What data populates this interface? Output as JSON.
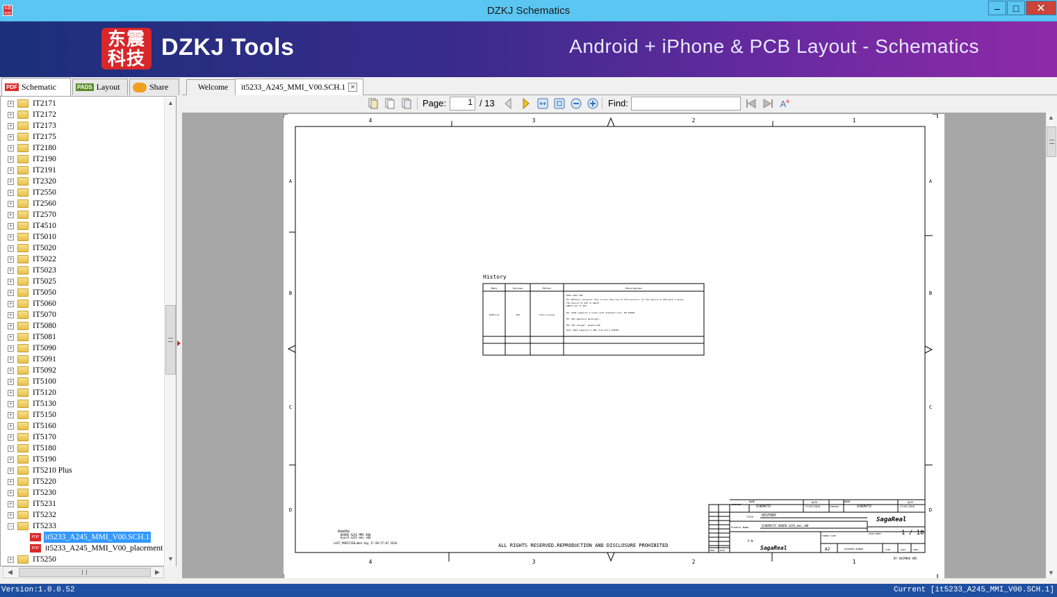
{
  "window": {
    "title": "DZKJ Schematics",
    "icon_text": "东震科技",
    "min": "–",
    "max": "□",
    "close": "✕"
  },
  "banner": {
    "logo_text": "东震科技",
    "brand": "DZKJ Tools",
    "tagline": "Android + iPhone & PCB Layout - Schematics"
  },
  "left_tabs": [
    {
      "badge": "PDF",
      "label": "Schematic",
      "active": true
    },
    {
      "badge": "PADS",
      "label": "Layout",
      "active": false
    },
    {
      "badge": "",
      "label": "Share",
      "active": false
    }
  ],
  "tree": {
    "folders": [
      "IT2171",
      "IT2172",
      "IT2173",
      "IT2175",
      "IT2180",
      "IT2190",
      "IT2191",
      "IT2320",
      "IT2550",
      "IT2560",
      "IT2570",
      "IT4510",
      "IT5010",
      "IT5020",
      "IT5022",
      "IT5023",
      "IT5025",
      "IT5050",
      "IT5060",
      "IT5070",
      "IT5080",
      "IT5081",
      "IT5090",
      "IT5091",
      "IT5092",
      "IT5100",
      "IT5120",
      "IT5130",
      "IT5150",
      "IT5160",
      "IT5170",
      "IT5180",
      "IT5190",
      "IT5210 Plus",
      "IT5220",
      "IT5230",
      "IT5231",
      "IT5232",
      "IT5233"
    ],
    "expanded_folder": "IT5233",
    "children": [
      "it5233_A245_MMI_V00.SCH.1",
      "it5233_A245_MMI_V00_placement"
    ],
    "selected_child": "it5233_A245_MMI_V00.SCH.1",
    "after": [
      "IT5250"
    ],
    "expand_symbol": "+",
    "collapse_symbol": "−"
  },
  "doc_tabs": [
    {
      "label": "Welcome",
      "active": false
    },
    {
      "label": "it5233_A245_MMI_V00.SCH.1",
      "active": true,
      "close": "✕"
    }
  ],
  "toolbar": {
    "page_label": "Page:",
    "page_value": "1",
    "page_total": "/ 13",
    "find_label": "Find:",
    "find_value": ""
  },
  "schematic": {
    "col_labels_top": [
      "4",
      "3",
      "2",
      "1"
    ],
    "row_labels": [
      "A",
      "B",
      "C",
      "D"
    ],
    "history_title": "History",
    "history_headers": [
      "Date",
      "Version",
      "Editor",
      "Description"
    ],
    "history_row": {
      "date": "2018/7/4",
      "version": "V00",
      "editor": "zhou xinrong",
      "description": [
        "DSP1 A245 V00",
        "P3: Battery connector have 5 pins they are in 2x2 position. So the device of 5V0 have 2 group.",
        "    The device of 5V0 is AAD12",
        "    AND13 out of 5V0",
        "P4: A245 supports 2 Cards with standard card. NO AVDDR.",
        "P5: A05 ambience backlight.",
        "P8: A05 charger: keeper:LED",
        "P10: A245 supports 2 SPK sink and 2 PAOTPS"
      ]
    },
    "footer_center": "ALL RIGHTS RESERVED.REPRODUCTION AND DISCLOSURE PROHIBITED",
    "footer_left": [
      "DRAWING:",
      "BOARD A245 MMI V00",
      "board a245 mmi v00",
      "LAST_MODIFIED=Wed Aug 17 09:57:07 2016"
    ],
    "titleblock": {
      "name1_label": "NAME",
      "name1": "SCHEMATIC",
      "date1_label": "DATE",
      "date1": "27/07/2016",
      "checked_label": "CHECKED",
      "name2_label": "NAME",
      "name2": "SCHEMATIC",
      "date2_label": "DATE",
      "date2": "27/07/2016",
      "modified_label": "MODIFIED",
      "title_label": "TITLE",
      "title": "HISTORY",
      "product_label": "Product Name",
      "product": "SCHEMATIC BOARD a245_mmi_v00",
      "brand": "SagaReal",
      "page_label": "PAGE/SHEET",
      "page": "1 / 10",
      "pn_label": "P.N.",
      "format_label": "FORMAT SIZE",
      "format": "A2",
      "docnum_label": "DOCUMENT NUMBER",
      "type_label": "TYPE",
      "part_label": "PART",
      "vers_label": "VERS.",
      "vers_small": "VERS.",
      "date_small": "DATE"
    },
    "byline": "BY SHIPNAO HOS"
  },
  "status": {
    "version": "Version:1.0.0.52",
    "current": "Current [it5233_A245_MMI_V00.SCH.1]"
  }
}
